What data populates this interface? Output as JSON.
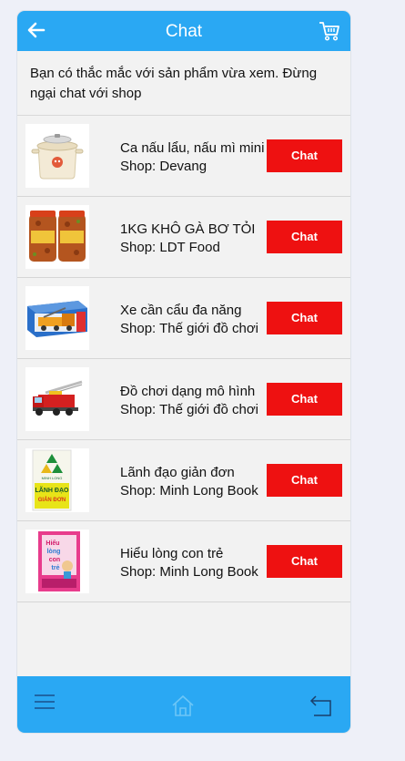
{
  "header": {
    "title": "Chat",
    "back_icon": "back-arrow-icon",
    "cart_icon": "shopping-cart-icon"
  },
  "intro_text": "Bạn có thắc mắc với sản phẩm vừa xem. Đừng ngại chat với shop",
  "products": [
    {
      "name": "Ca nấu lẩu, nấu mì mini",
      "shop": "Shop: Devang",
      "button": "Chat"
    },
    {
      "name": "1KG KHÔ GÀ BƠ TỎI",
      "shop": "Shop: LDT Food",
      "button": "Chat"
    },
    {
      "name": "Xe cần cẩu đa năng",
      "shop": "Shop: Thế giới đồ chơi",
      "button": "Chat"
    },
    {
      "name": "Đồ chơi dạng mô hình",
      "shop": "Shop: Thế giới đồ chơi",
      "button": "Chat"
    },
    {
      "name": "Lãnh đạo giản đơn",
      "shop": "Shop: Minh Long Book",
      "button": "Chat"
    },
    {
      "name": "Hiểu lòng con trẻ",
      "shop": "Shop: Minh Long Book",
      "button": "Chat"
    }
  ],
  "book_covers": {
    "leadership_brand": "MINH LONG",
    "leadership_title_1": "LÃNH ĐẠO",
    "leadership_title_2": "GIẢN ĐƠN",
    "parenting_title_1": "Hiểu",
    "parenting_title_2": "lòng",
    "parenting_title_3": "con",
    "parenting_title_4": "trẻ"
  },
  "footer": {
    "menu_icon": "hamburger-menu-icon",
    "home_icon": "home-icon",
    "return_icon": "return-icon"
  },
  "colors": {
    "accent": "#2aa8f3",
    "chat_button": "#ee1111",
    "background": "#f2f2f2"
  }
}
